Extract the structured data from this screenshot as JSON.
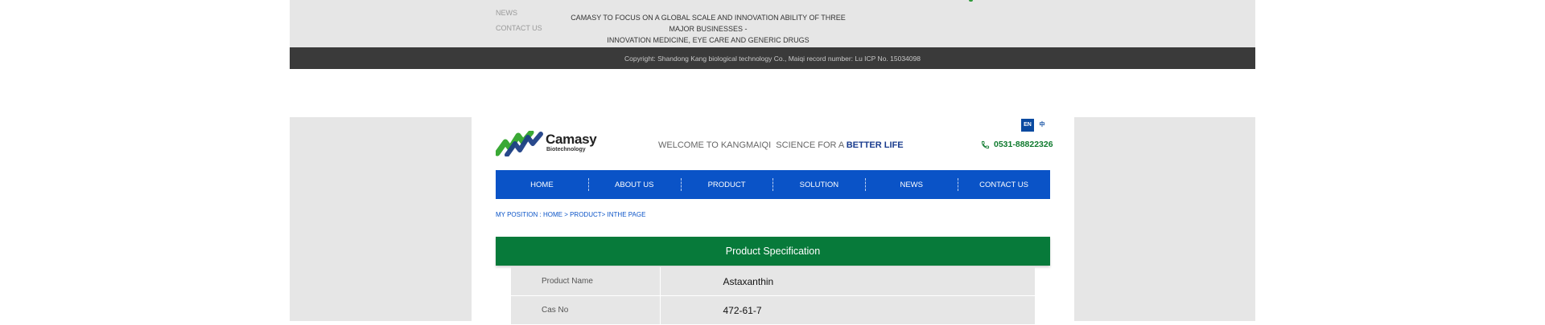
{
  "footer": {
    "nav": [
      "NEWS",
      "CONTACT US"
    ],
    "tagline_line1": "CAMASY TO FOCUS ON A GLOBAL SCALE AND INNOVATION ABILITY OF THREE MAJOR BUSINESSES -",
    "tagline_line2": "INNOVATION MEDICINE, EYE CARE AND GENERIC DRUGS",
    "copyright": "Copyright: Shandong Kang biological technology Co., Maiqi record number: Lu ICP No. 15034098"
  },
  "header": {
    "logo_main": "Camasy",
    "logo_sub": "Biotechnology",
    "welcome_prefix": "WELCOME TO KANGMAIQI  SCIENCE FOR A ",
    "welcome_highlight": "BETTER LIFE",
    "lang_en": "EN",
    "lang_zh": "中",
    "phone": "0531-88822326",
    "phone_icon": "phone-icon"
  },
  "nav": {
    "items": [
      "HOME",
      "ABOUT US",
      "PRODUCT",
      "SOLUTION",
      "NEWS",
      "CONTACT US"
    ]
  },
  "breadcrumb": "MY POSITION : HOME > PRODUCT> INTHE PAGE",
  "spec": {
    "title": "Product Specification",
    "rows": [
      {
        "label": "Product Name",
        "value": "Astaxanthin"
      },
      {
        "label": "Cas No",
        "value": "472-61-7"
      }
    ]
  },
  "colors": {
    "nav_blue": "#0a53c7",
    "spec_green": "#077a3a",
    "phone_green": "#0f7a2e",
    "footer_gray": "#e6e6e6",
    "copyright_dark": "#3a3a3a"
  }
}
